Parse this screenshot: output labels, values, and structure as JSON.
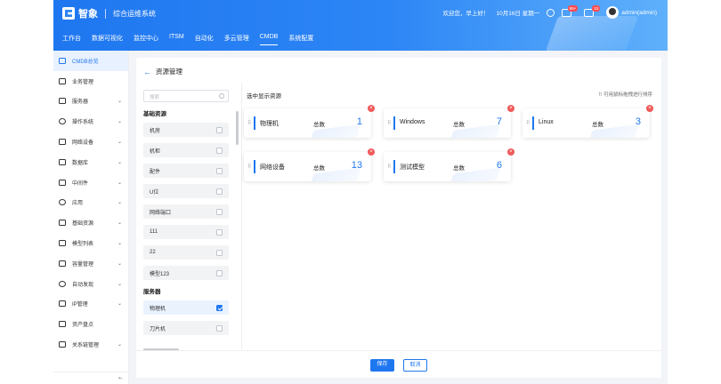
{
  "header": {
    "logo_text": "智象",
    "system_title": "综合运维系统",
    "greeting": "欢迎您，早上好！",
    "date": "10月16日 星期一",
    "badge_1": "99+",
    "badge_2": "10",
    "user": "admin(admin)",
    "nav": [
      "工作台",
      "数据可视化",
      "监控中心",
      "ITSM",
      "自动化",
      "多云管理",
      "CMDB",
      "系统配置"
    ],
    "active_nav": "CMDB"
  },
  "sidebar": {
    "items": [
      {
        "label": "CMDB总览",
        "active": true,
        "chevron": false
      },
      {
        "label": "业务管理",
        "active": false,
        "chevron": false
      },
      {
        "label": "服务器",
        "active": false,
        "chevron": true
      },
      {
        "label": "操作系统",
        "active": false,
        "chevron": true
      },
      {
        "label": "网络设备",
        "active": false,
        "chevron": true
      },
      {
        "label": "数据库",
        "active": false,
        "chevron": true
      },
      {
        "label": "中间件",
        "active": false,
        "chevron": true
      },
      {
        "label": "应用",
        "active": false,
        "chevron": true
      },
      {
        "label": "基础资源",
        "active": false,
        "chevron": true
      },
      {
        "label": "模型列表",
        "active": false,
        "chevron": true
      },
      {
        "label": "容量管理",
        "active": false,
        "chevron": true
      },
      {
        "label": "自动发现",
        "active": false,
        "chevron": true
      },
      {
        "label": "IP管理",
        "active": false,
        "chevron": true
      },
      {
        "label": "资产盘点",
        "active": false,
        "chevron": false
      },
      {
        "label": "关系链管理",
        "active": false,
        "chevron": true
      }
    ]
  },
  "page": {
    "title": "资源管理",
    "search_placeholder": "搜索",
    "groups": [
      {
        "title": "基础资源",
        "options": [
          {
            "label": "机房",
            "checked": false
          },
          {
            "label": "机柜",
            "checked": false
          },
          {
            "label": "配件",
            "checked": false
          },
          {
            "label": "U位",
            "checked": false
          },
          {
            "label": "网络端口",
            "checked": false
          },
          {
            "label": "111",
            "checked": false
          },
          {
            "label": "22",
            "checked": false
          },
          {
            "label": "模型123",
            "checked": false
          }
        ]
      },
      {
        "title": "服务器",
        "options": [
          {
            "label": "物理机",
            "checked": true
          },
          {
            "label": "刀片机",
            "checked": false
          }
        ]
      }
    ],
    "selected_title": "选中显示资源",
    "drag_hint": "可用鼠标拖拽进行排序",
    "total_label": "总数",
    "cards": [
      {
        "name": "物理机",
        "count": "1"
      },
      {
        "name": "Windows",
        "count": "7"
      },
      {
        "name": "Linux",
        "count": "3"
      },
      {
        "name": "网络设备",
        "count": "13"
      },
      {
        "name": "测试模型",
        "count": "6"
      }
    ],
    "save_label": "保存",
    "cancel_label": "取消"
  },
  "colors": {
    "primary": "#1f77f0",
    "danger": "#f05a5a"
  }
}
